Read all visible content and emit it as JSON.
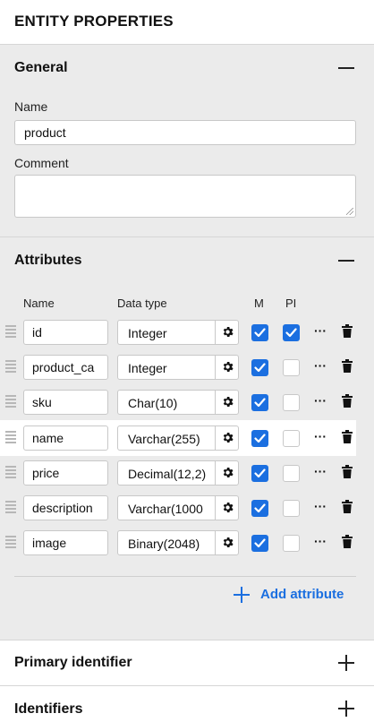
{
  "panel": {
    "title": "ENTITY PROPERTIES"
  },
  "general": {
    "title": "General",
    "name_label": "Name",
    "name_value": "product",
    "comment_label": "Comment",
    "comment_value": ""
  },
  "attributes": {
    "title": "Attributes",
    "columns": {
      "name": "Name",
      "data_type": "Data type",
      "mandatory": "M",
      "primary": "PI"
    },
    "rows": [
      {
        "name": "id",
        "data_type": "Integer",
        "mandatory": true,
        "primary": true
      },
      {
        "name": "product_ca",
        "data_type": "Integer",
        "mandatory": true,
        "primary": false
      },
      {
        "name": "sku",
        "data_type": "Char(10)",
        "mandatory": true,
        "primary": false
      },
      {
        "name": "name",
        "data_type": "Varchar(255)",
        "mandatory": true,
        "primary": false
      },
      {
        "name": "price",
        "data_type": "Decimal(12,2)",
        "mandatory": true,
        "primary": false
      },
      {
        "name": "description",
        "data_type": "Varchar(1000",
        "mandatory": true,
        "primary": false
      },
      {
        "name": "image",
        "data_type": "Binary(2048)",
        "mandatory": true,
        "primary": false
      }
    ],
    "add_label": "Add attribute"
  },
  "primary_identifier": {
    "title": "Primary identifier"
  },
  "identifiers": {
    "title": "Identifiers"
  },
  "colors": {
    "accent": "#1b6fe0",
    "section_bg": "#ebebeb"
  }
}
